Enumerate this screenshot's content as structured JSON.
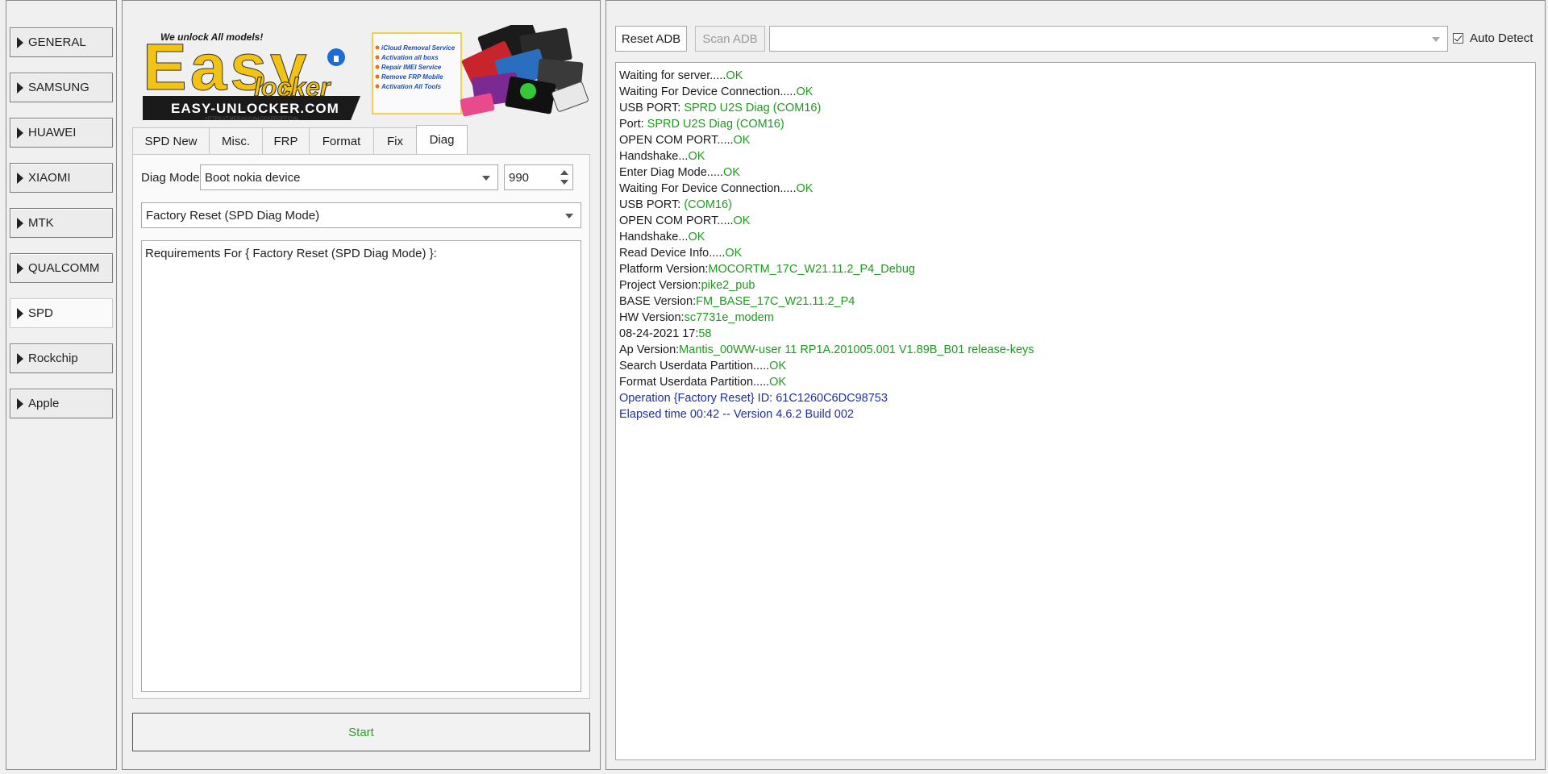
{
  "sidebar": {
    "items": [
      {
        "label": "GENERAL"
      },
      {
        "label": "SAMSUNG"
      },
      {
        "label": "HUAWEI"
      },
      {
        "label": "XIAOMI"
      },
      {
        "label": "MTK"
      },
      {
        "label": "QUALCOMM"
      },
      {
        "label": "SPD",
        "active": true
      },
      {
        "label": "Rockchip"
      },
      {
        "label": "Apple"
      }
    ]
  },
  "banner": {
    "brand_top": "Easy",
    "brand_bottom": "locker",
    "tagline": "We unlock All models!",
    "website": "EASY-UNLOCKER.COM",
    "url_small": "HTTPS://T.ME/EASYUNLOCKEROFFICIAL",
    "services": [
      "iCloud Removal Service",
      "Activation all boxs",
      "Repair IMEI Service",
      "Remove FRP Mobile",
      "Activation All Tools"
    ]
  },
  "tabs": [
    "SPD New",
    "Misc.",
    "FRP",
    "Format",
    "Fix",
    "Diag"
  ],
  "active_tab": "Diag",
  "diag": {
    "mode_label": "Diag Mode",
    "mode_value": "Boot nokia device",
    "spin_value": "990",
    "operation_value": "Factory Reset (SPD Diag Mode)",
    "requirements_text": "Requirements For { Factory Reset (SPD Diag Mode) }:"
  },
  "start_label": "Start",
  "toolbar": {
    "reset_adb": "Reset ADB",
    "scan_adb": "Scan ADB",
    "port_value": "",
    "auto_detect": "Auto Detect",
    "auto_detect_checked": true
  },
  "log": [
    {
      "text": "Waiting for server.....",
      "status": "OK"
    },
    {
      "text": "Waiting For Device Connection.....",
      "status": "OK"
    },
    {
      "text": "USB PORT: ",
      "status": "SPRD U2S Diag (COM16)"
    },
    {
      "text": "Port: ",
      "status": "SPRD U2S Diag (COM16)"
    },
    {
      "text": "OPEN COM PORT.....",
      "status": "OK"
    },
    {
      "text": "Handshake...",
      "status": "OK"
    },
    {
      "text": "Enter Diag Mode.....",
      "status": "OK"
    },
    {
      "text": "Waiting For Device Connection.....",
      "status": "OK"
    },
    {
      "text": "USB PORT: ",
      "status": "(COM16)"
    },
    {
      "text": "OPEN COM PORT.....",
      "status": "OK"
    },
    {
      "text": "Handshake...",
      "status": "OK"
    },
    {
      "text": "Read Device Info.....",
      "status": "OK"
    },
    {
      "text": "Platform Version:",
      "status": "MOCORTM_17C_W21.11.2_P4_Debug"
    },
    {
      "text": "Project Version:",
      "status": "pike2_pub"
    },
    {
      "text": "BASE Version:",
      "status": "FM_BASE_17C_W21.11.2_P4"
    },
    {
      "text": "HW Version:",
      "status": "sc7731e_modem"
    },
    {
      "text": "08-24-2021 17:",
      "status": "58"
    },
    {
      "text": "Ap Version:",
      "status": "Mantis_00WW-user 11 RP1A.201005.001 V1.89B_B01 release-keys"
    },
    {
      "text": "Search Userdata Partition.....",
      "status": "OK"
    },
    {
      "text": "Format Userdata Partition.....",
      "status": "OK"
    },
    {
      "text": "",
      "info": "Operation {Factory Reset} ID: 61C1260C6DC98753"
    },
    {
      "text": "",
      "info": "Elapsed time 00:42 -- Version 4.6.2 Build 002"
    }
  ],
  "colors": {
    "ok": "#1e9a1e",
    "info": "#1e2fa0",
    "start_text": "#2aa02a"
  }
}
